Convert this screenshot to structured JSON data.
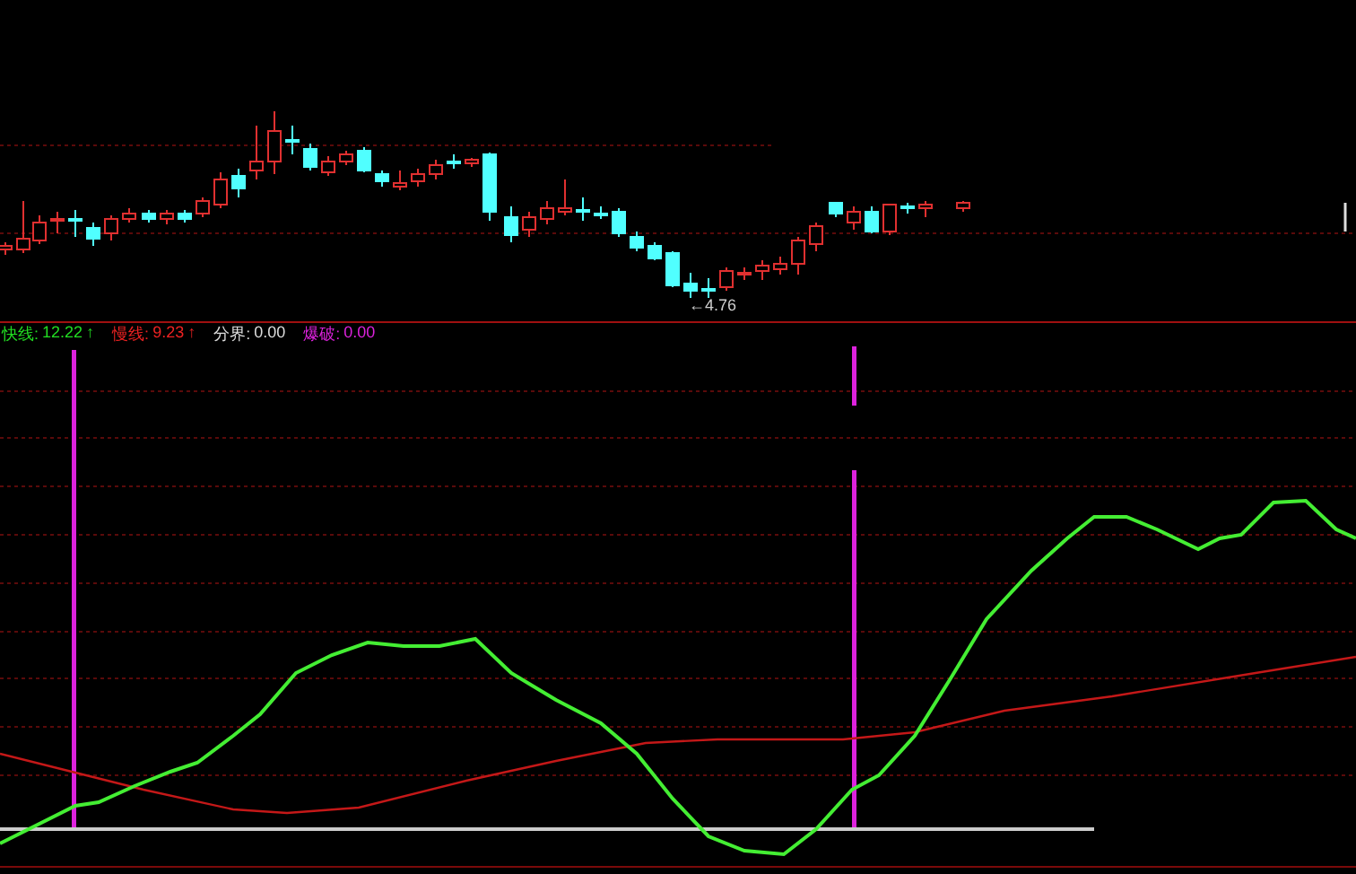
{
  "price_chart": {
    "low_price_label": "←4.76"
  },
  "indicator_legend": [
    {
      "name": "快线:",
      "value": "12.22",
      "arrow": "↑",
      "color": "#22dd22"
    },
    {
      "name": "慢线:",
      "value": "9.23",
      "arrow": "↑",
      "color": "#ee2222"
    },
    {
      "name": "分界:",
      "value": "0.00",
      "color": "#dddddd"
    },
    {
      "name": "爆破:",
      "value": "0.00",
      "color": "#dd22dd"
    }
  ]
}
